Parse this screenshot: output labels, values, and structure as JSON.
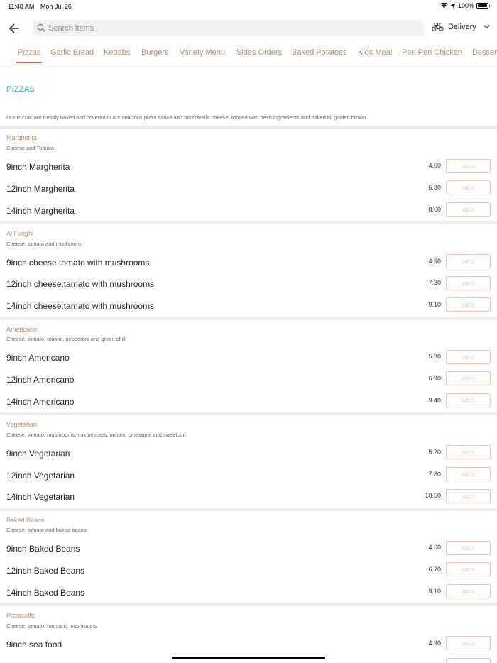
{
  "status_bar": {
    "time": "11:48 AM",
    "date": "Mon Jul 26",
    "battery": "100%"
  },
  "search": {
    "placeholder": "Search items"
  },
  "delivery": {
    "label": "Delivery"
  },
  "tabs": [
    {
      "label": "Pizzas",
      "active": true
    },
    {
      "label": "Garlic Bread"
    },
    {
      "label": "Kebabs"
    },
    {
      "label": "Burgers"
    },
    {
      "label": "Variety Menu"
    },
    {
      "label": "Sides Orders"
    },
    {
      "label": "Baked Potatoes"
    },
    {
      "label": "Kids Meal"
    },
    {
      "label": "Peri Peri Chicken"
    },
    {
      "label": "Desserts"
    }
  ],
  "section": {
    "title": "PIZZAS",
    "description": "Our Pizzas are freshly baked and covered in our delicious pizza sauce and mozzarella cheese, topped with fresh ingredients and baked till golden brown."
  },
  "add_label": "ADD",
  "groups": [
    {
      "name": "Margherita",
      "description": "Cheese and Tomato",
      "items": [
        {
          "name": "9inch Margherita",
          "price": "4.00"
        },
        {
          "name": "12inch Margherita",
          "price": "6.30"
        },
        {
          "name": "14inch Margherita",
          "price": "8.60"
        }
      ]
    },
    {
      "name": "Al Funghi",
      "description": "Cheese, tomato and mushroom",
      "items": [
        {
          "name": "9inch cheese tomato with mushrooms",
          "price": "4.90"
        },
        {
          "name": "12inch cheese,tamato with mushrooms",
          "price": "7.30"
        },
        {
          "name": "14inch cheese,tamato with mushrooms",
          "price": "9.10"
        }
      ]
    },
    {
      "name": "Americano",
      "description": "Cheese, tomato, onions, pepperoni and green chilli",
      "items": [
        {
          "name": "9inch Americano",
          "price": "5.30"
        },
        {
          "name": "12inch Americano",
          "price": "6.90"
        },
        {
          "name": "14inch Americano",
          "price": "9.40"
        }
      ]
    },
    {
      "name": "Vegetarian",
      "description": "Cheese, tomato, mushrooms, mix peppers, onions, pineapple and sweetcorn",
      "items": [
        {
          "name": "9inch Vegetarian",
          "price": "5.20"
        },
        {
          "name": "12inch Vegetarian",
          "price": "7.80"
        },
        {
          "name": "14inch Vegetarian",
          "price": "10.50"
        }
      ]
    },
    {
      "name": "Baked Beans",
      "description": "Cheese, tomato and baked beans",
      "items": [
        {
          "name": "9inch Baked Beans",
          "price": "4.60"
        },
        {
          "name": "12inch Baked Beans",
          "price": "6.70"
        },
        {
          "name": "14inch Baked Beans",
          "price": "9.10"
        }
      ]
    },
    {
      "name": "Proscuitto",
      "description": "Cheese, tomato, ham and mushrooms",
      "items": [
        {
          "name": "9inch sea food",
          "price": "4.90"
        }
      ]
    }
  ]
}
